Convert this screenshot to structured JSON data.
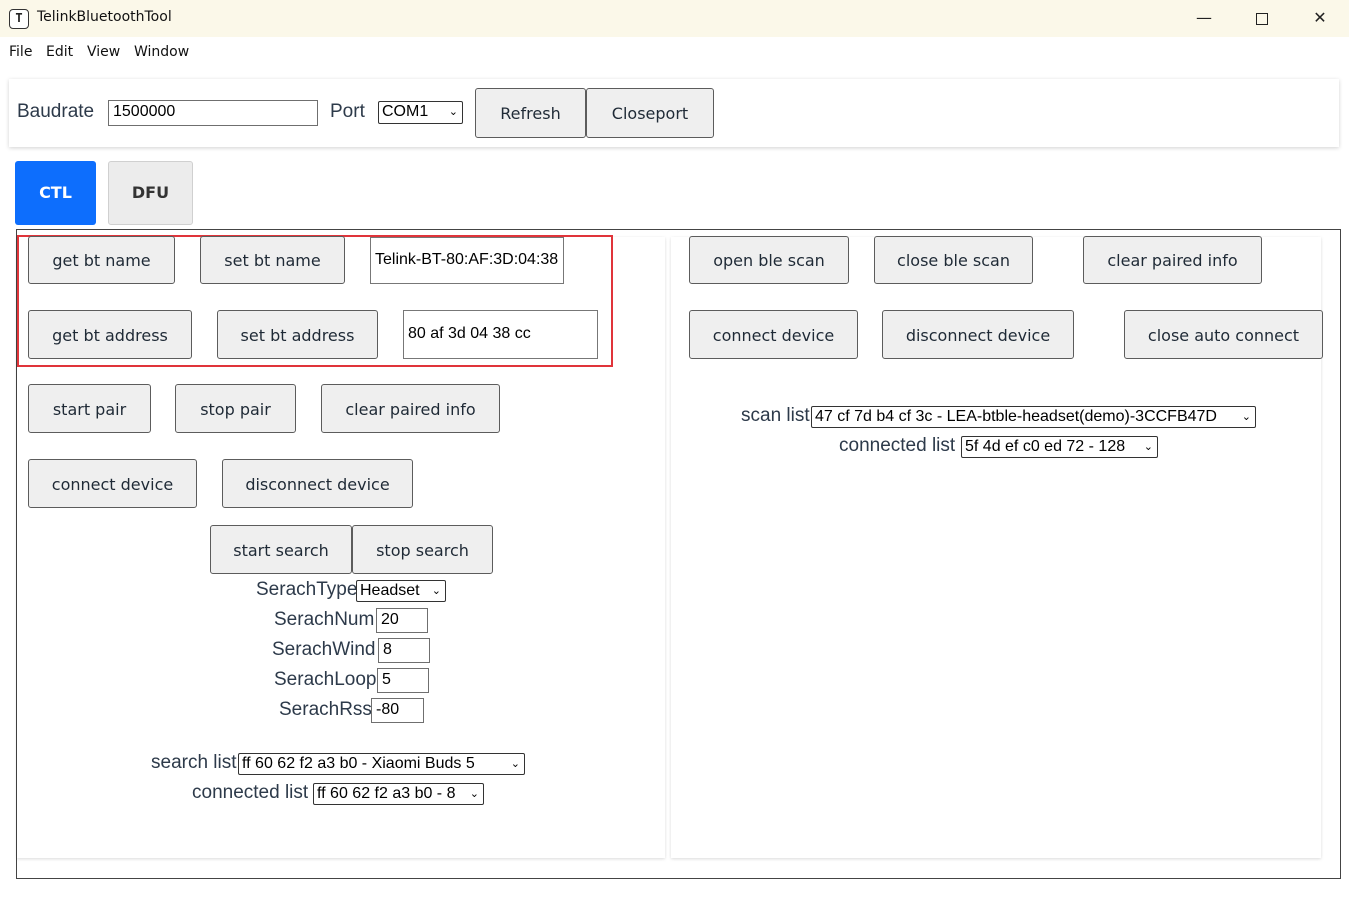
{
  "window": {
    "title": "TelinkBluetoothTool",
    "icon": "telink-app-icon",
    "icon_glyph": "T",
    "controls": {
      "minimize": "—",
      "maximize": "",
      "close": "✕"
    }
  },
  "menu": [
    "File",
    "Edit",
    "View",
    "Window"
  ],
  "toolbar": {
    "baudrate_label": "Baudrate",
    "baudrate_value": "1500000",
    "port_label": "Port",
    "port_value": "COM1",
    "refresh_label": "Refresh",
    "closeport_label": "Closeport"
  },
  "tabs": [
    {
      "label": "CTL",
      "active": true
    },
    {
      "label": "DFU",
      "active": false
    }
  ],
  "left": {
    "get_bt_name": "get bt name",
    "set_bt_name": "set bt name",
    "bt_name_value": "Telink-BT-80:AF:3D:04:38",
    "get_bt_address": "get bt address",
    "set_bt_address": "set bt address",
    "bt_address_value": "80 af 3d 04 38 cc",
    "start_pair": "start pair",
    "stop_pair": "stop pair",
    "clear_paired_info": "clear paired info",
    "connect_device": "connect device",
    "disconnect_device": "disconnect device",
    "start_search": "start search",
    "stop_search": "stop search",
    "search_type_label": "SerachType",
    "search_type_value": "Headset",
    "search_num_label": "SerachNum",
    "search_num_value": "20",
    "search_wind_label": "SerachWind",
    "search_wind_value": "8",
    "search_loop_label": "SerachLoop",
    "search_loop_value": "5",
    "search_rssi_label": "SerachRssi",
    "search_rssi_value": "-80",
    "search_list_label": "search list",
    "search_list_value": "ff 60 62 f2 a3 b0 - Xiaomi Buds 5",
    "connected_list_label": "connected list",
    "connected_list_value": "ff 60 62 f2 a3 b0 - 8"
  },
  "right": {
    "open_ble_scan": "open ble scan",
    "close_ble_scan": "close ble scan",
    "clear_paired_info": "clear paired info",
    "connect_device": "connect device",
    "disconnect_device": "disconnect device",
    "close_auto_connect": "close auto connect",
    "scan_list_label": "scan list",
    "scan_list_value": "47 cf 7d b4 cf 3c - LEA-btble-headset(demo)-3CCFB47D",
    "connected_list_label": "connected list",
    "connected_list_value": "5f 4d ef c0 ed 72 - 128"
  },
  "colors": {
    "accent": "#0d6efd",
    "highlight_border": "#e0343a",
    "titlebar_bg": "#fbf8e9",
    "button_bg": "#efefef"
  }
}
